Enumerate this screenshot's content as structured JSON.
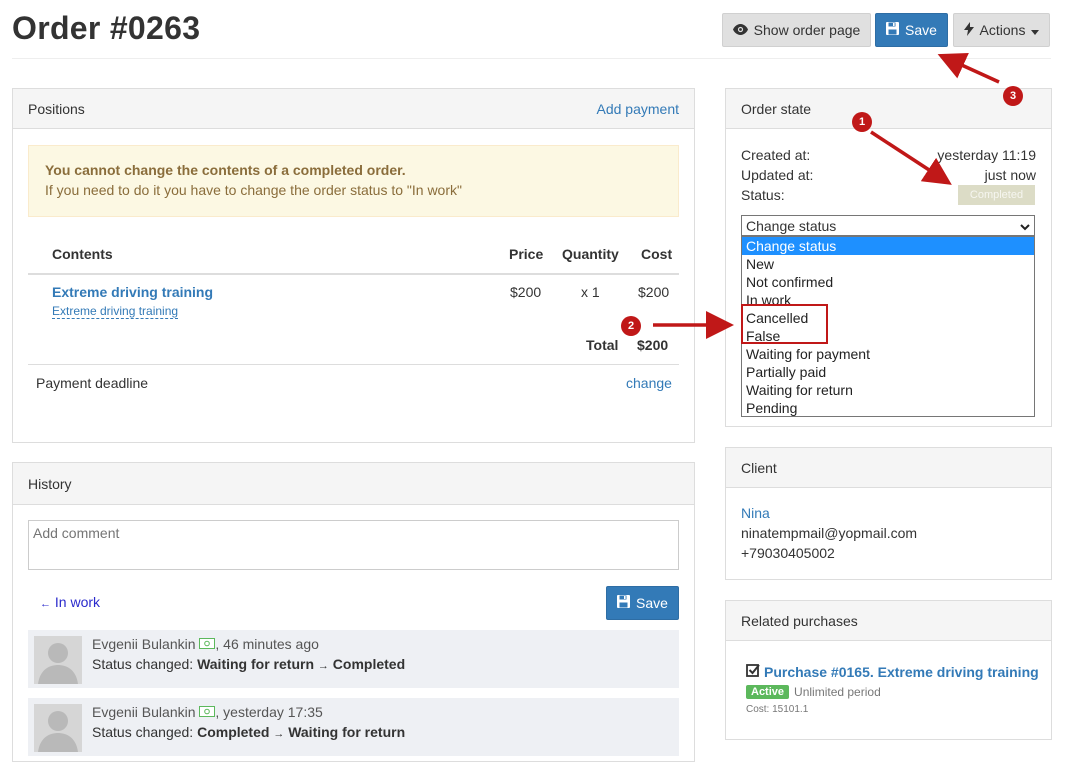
{
  "header": {
    "title": "Order #0263",
    "show_order_page": "Show order page",
    "save": "Save",
    "actions": "Actions"
  },
  "positions": {
    "title": "Positions",
    "add_payment": "Add payment",
    "alert_title": "You cannot change the contents of a completed order.",
    "alert_text": "If you need to do it you have to change the order status to \"In work\"",
    "columns": [
      "Contents",
      "Price",
      "Quantity",
      "Cost"
    ],
    "rows": [
      {
        "name": "Extreme driving training",
        "sub": "Extreme driving training",
        "price": "$200",
        "qty": "x 1",
        "cost": "$200"
      }
    ],
    "total_label": "Total",
    "total_value": "$200",
    "deadline_label": "Payment deadline",
    "deadline_action": "change"
  },
  "history": {
    "title": "History",
    "comment_placeholder": "Add comment",
    "back_link": "In work",
    "save": "Save",
    "items": [
      {
        "author": "Evgenii Bulankin",
        "time": ", 46 minutes ago",
        "label": "Status changed: ",
        "from": "Waiting for return",
        "to": "Completed"
      },
      {
        "author": "Evgenii Bulankin",
        "time": ", yesterday 17:35",
        "label": "Status changed: ",
        "from": "Completed",
        "to": "Waiting for return"
      }
    ]
  },
  "order_state": {
    "title": "Order state",
    "created_label": "Created at:",
    "created_value": "yesterday 11:19",
    "updated_label": "Updated at:",
    "updated_value": "just now",
    "status_label": "Status:",
    "status_value": "Completed",
    "select_value": "Change status",
    "options": [
      "Change status",
      "New",
      "Not confirmed",
      "In work",
      "Cancelled",
      "False",
      "Waiting for payment",
      "Partially paid",
      "Waiting for return",
      "Pending"
    ]
  },
  "client": {
    "title": "Client",
    "name": "Nina",
    "email": "ninatempmail@yopmail.com",
    "phone": "+79030405002"
  },
  "related": {
    "title": "Related purchases",
    "purchase": "Purchase #0165. Extreme driving training",
    "badge": "Active",
    "period": "Unlimited period",
    "cost": "Cost: 15101.1"
  },
  "markers": [
    "1",
    "2",
    "3"
  ],
  "colors": {
    "primary": "#337ab7",
    "annotation": "#c01818",
    "highlight": "#1e90ff"
  }
}
